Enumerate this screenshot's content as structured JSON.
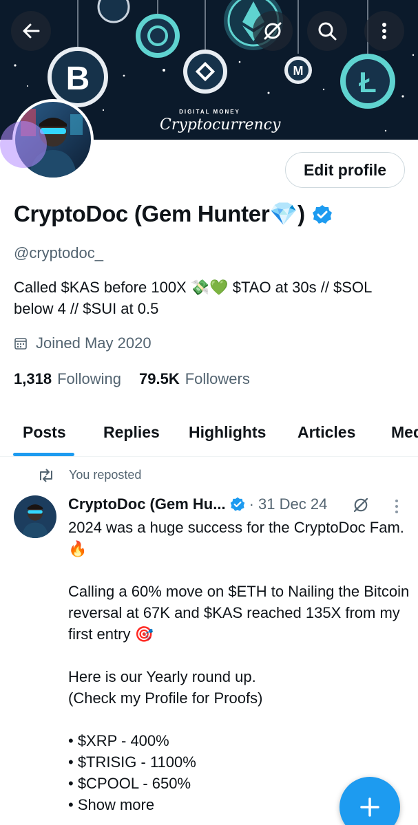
{
  "banner": {
    "subtitle": "DIGITAL MONEY",
    "title": "Cryptocurrency",
    "coins": [
      "bitcoin-coin",
      "ripple-coin",
      "ethereum-coin",
      "binance-coin",
      "monero-coin",
      "litecoin-coin",
      "cardano-coin"
    ]
  },
  "toolbar": {
    "back_icon": "back-arrow-icon",
    "grok_icon": "grok-icon",
    "search_icon": "search-icon",
    "more_icon": "more-vertical-icon"
  },
  "profile": {
    "edit_label": "Edit profile",
    "name": "CryptoDoc (Gem Hunter💎)",
    "handle": "@cryptodoc_",
    "bio": "Called $KAS before 100X 💸💚 $TAO at 30s // $SOL below 4 // $SUI at 0.5",
    "joined": "Joined May 2020",
    "following_count": "1,318",
    "following_label": "Following",
    "followers_count": "79.5K",
    "followers_label": "Followers"
  },
  "tabs": [
    {
      "label": "Posts",
      "active": true
    },
    {
      "label": "Replies"
    },
    {
      "label": "Highlights"
    },
    {
      "label": "Articles"
    },
    {
      "label": "Media"
    }
  ],
  "post": {
    "repost_label": "You reposted",
    "author": "CryptoDoc (Gem Hu...",
    "date": "· 31 Dec 24",
    "lines": [
      "2024 was a huge success for the CryptoDoc Fam. 🔥",
      "",
      "Calling a 60% move on $ETH to Nailing the Bitcoin reversal at 67K and $KAS reached 135X from my first entry 🎯",
      "",
      "Here is our Yearly round up.",
      "(Check my Profile for Proofs)",
      "",
      "• $XRP - 400%",
      "• $TRISIG - 1100%",
      "• $CPOOL - 650%"
    ],
    "show_more": "• Show more"
  },
  "colors": {
    "accent": "#1d9bf0",
    "banner_bg": "#0b1a2b",
    "coin_teal": "#5fd3d0",
    "secondary_text": "#536471"
  }
}
